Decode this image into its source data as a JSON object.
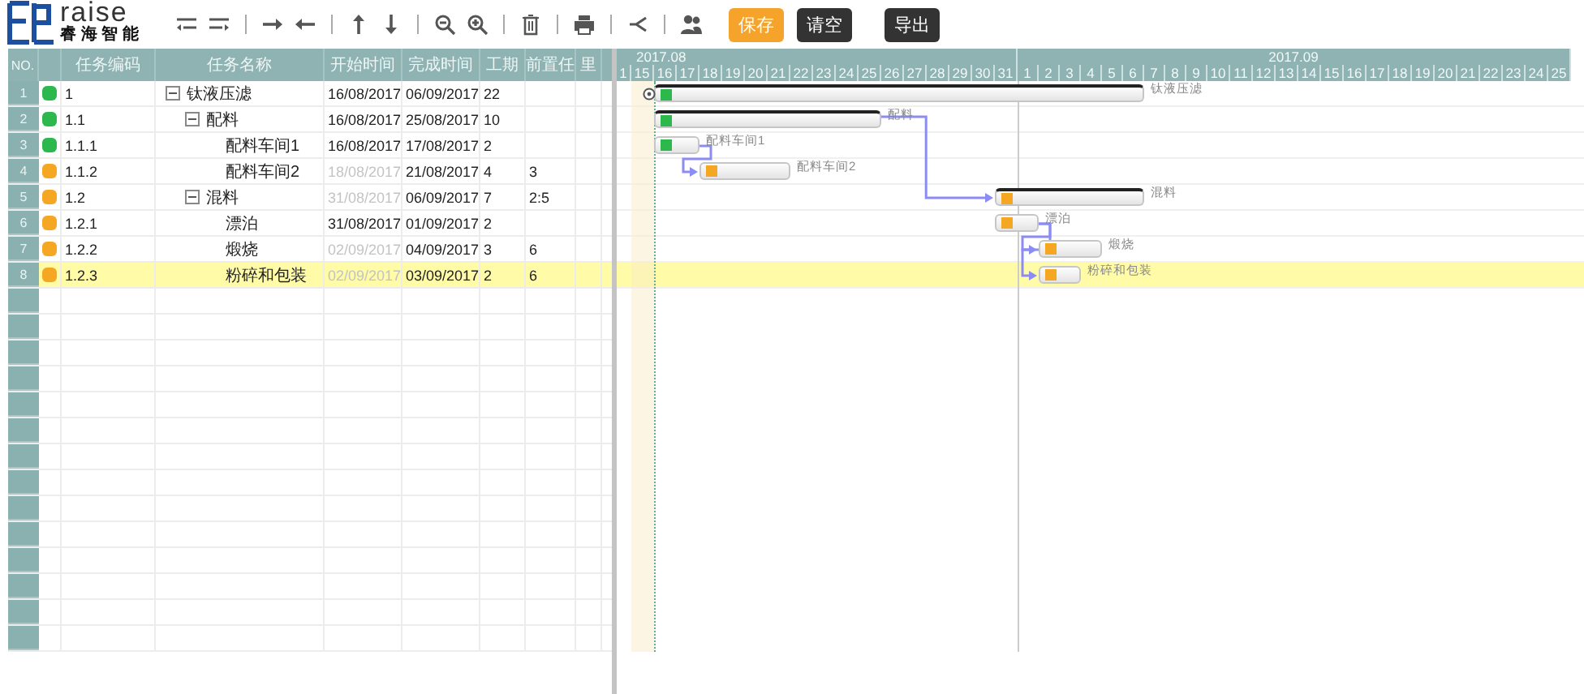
{
  "logo": {
    "wordmark": "raise",
    "tagline": "睿 海 智 能"
  },
  "toolbar": {
    "buttons": [
      {
        "label": "保存",
        "kind": "primary"
      },
      {
        "label": "请空",
        "kind": "dark"
      },
      {
        "label": "导出",
        "kind": "dark"
      }
    ]
  },
  "grid": {
    "columns": [
      "NO.",
      "任务编码",
      "任务名称",
      "开始时间",
      "完成时间",
      "工期",
      "前置任",
      "里"
    ]
  },
  "timeline": {
    "months": [
      {
        "label": "2017.08",
        "days": [
          "1",
          "15",
          "16",
          "17",
          "18",
          "19",
          "20",
          "21",
          "22",
          "23",
          "24",
          "25",
          "26",
          "27",
          "28",
          "29",
          "30",
          "31"
        ]
      },
      {
        "label": "2017.09",
        "days": [
          "1",
          "2",
          "3",
          "4",
          "5",
          "6",
          "7",
          "8",
          "9",
          "10",
          "11",
          "12",
          "13",
          "14",
          "15",
          "16",
          "17",
          "18",
          "19",
          "20",
          "21",
          "22",
          "23",
          "24",
          "25"
        ]
      }
    ]
  },
  "tasks": [
    {
      "no": "1",
      "code": "1",
      "name": "钛液压滤",
      "start": "16/08/2017",
      "end": "06/09/2017",
      "duration": "22",
      "color": "#2db84d",
      "start_auto": false,
      "expanded": true,
      "selected": false,
      "bar_label": "钛液压滤",
      "children": [
        {
          "no": "2",
          "code": "1.1",
          "name": "配料",
          "start": "16/08/2017",
          "end": "25/08/2017",
          "duration": "10",
          "color": "#2db84d",
          "start_auto": false,
          "expanded": true,
          "selected": false,
          "bar_label": "配料",
          "children": [
            {
              "no": "3",
              "code": "1.1.1",
              "name": "配料车间1",
              "start": "16/08/2017",
              "end": "17/08/2017",
              "duration": "2",
              "color": "#2db84d",
              "start_auto": false,
              "selected": false,
              "bar_label": "配料车间1"
            },
            {
              "no": "4",
              "code": "1.1.2",
              "name": "配料车间2",
              "start": "18/08/2017",
              "end": "21/08/2017",
              "duration": "4",
              "predecessors": "3",
              "color": "#f5a623",
              "start_auto": true,
              "selected": false,
              "bar_label": "配料车间2"
            }
          ]
        },
        {
          "no": "5",
          "code": "1.2",
          "name": "混料",
          "start": "31/08/2017",
          "end": "06/09/2017",
          "duration": "7",
          "predecessors": "2:5",
          "color": "#f5a623",
          "start_auto": true,
          "expanded": true,
          "selected": false,
          "bar_label": "混料",
          "children": [
            {
              "no": "6",
              "code": "1.2.1",
              "name": "漂泊",
              "start": "31/08/2017",
              "end": "01/09/2017",
              "duration": "2",
              "color": "#f5a623",
              "start_auto": false,
              "selected": false,
              "bar_label": "漂泊"
            },
            {
              "no": "7",
              "code": "1.2.2",
              "name": "煅烧",
              "start": "02/09/2017",
              "end": "04/09/2017",
              "duration": "3",
              "predecessors": "6",
              "color": "#f5a623",
              "start_auto": true,
              "selected": false,
              "bar_label": "煅烧"
            },
            {
              "no": "8",
              "code": "1.2.3",
              "name": "粉碎和包装",
              "start": "02/09/2017",
              "end": "03/09/2017",
              "duration": "2",
              "predecessors": "6",
              "color": "#f5a623",
              "start_auto": true,
              "selected": true,
              "bar_label": "粉碎和包装"
            }
          ]
        }
      ]
    }
  ]
}
